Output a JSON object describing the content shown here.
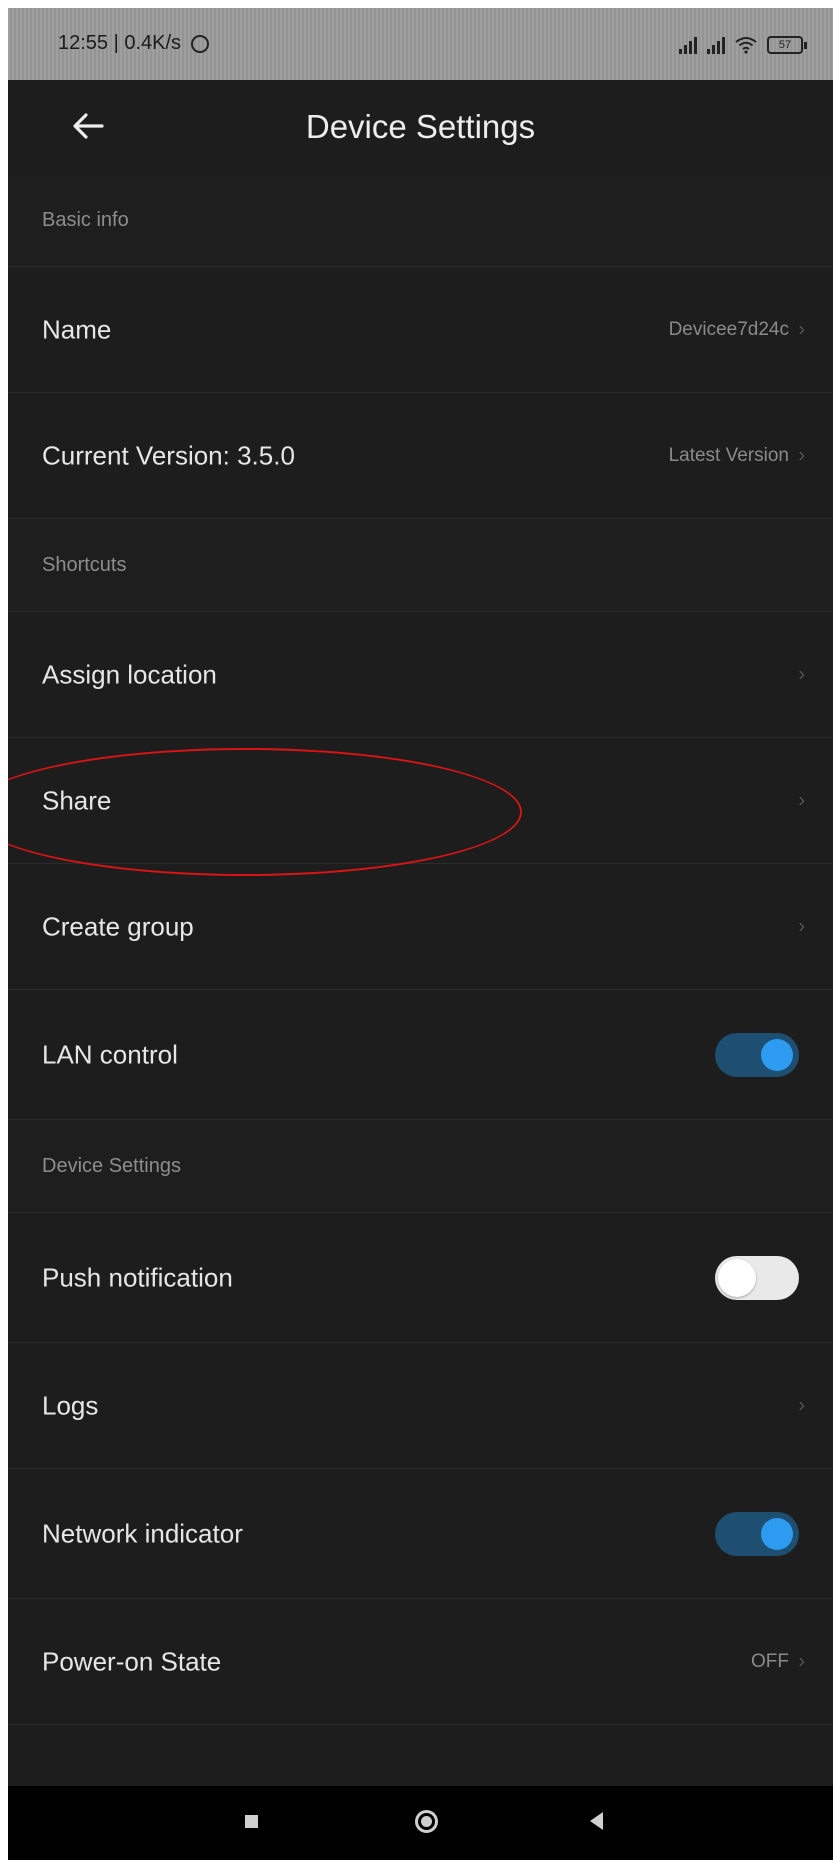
{
  "status_bar": {
    "time_speed": "12:55 | 0.4K/s",
    "battery": "57"
  },
  "header": {
    "title": "Device Settings",
    "back_icon": "arrow-left-icon"
  },
  "sections": {
    "basic_info": {
      "title": "Basic info",
      "name_label": "Name",
      "name_value": "Devicee7d24c",
      "version_label": "Current Version:  3.5.0",
      "version_value": "Latest Version"
    },
    "shortcuts": {
      "title": "Shortcuts",
      "assign_location": "Assign location",
      "share": "Share",
      "create_group": "Create group",
      "lan_control": "LAN control",
      "lan_control_on": true
    },
    "device_settings": {
      "title": "Device Settings",
      "push_notification": "Push notification",
      "push_notification_on": false,
      "logs": "Logs",
      "network_indicator": "Network indicator",
      "network_indicator_on": true,
      "power_on_state": "Power-on State",
      "power_on_state_value": "OFF"
    }
  },
  "chevron": "›",
  "colors": {
    "background": "#1d1d1d",
    "toggle_on_track": "#1f4f70",
    "toggle_on_knob": "#2d9cf0",
    "annotation": "#d81414"
  }
}
